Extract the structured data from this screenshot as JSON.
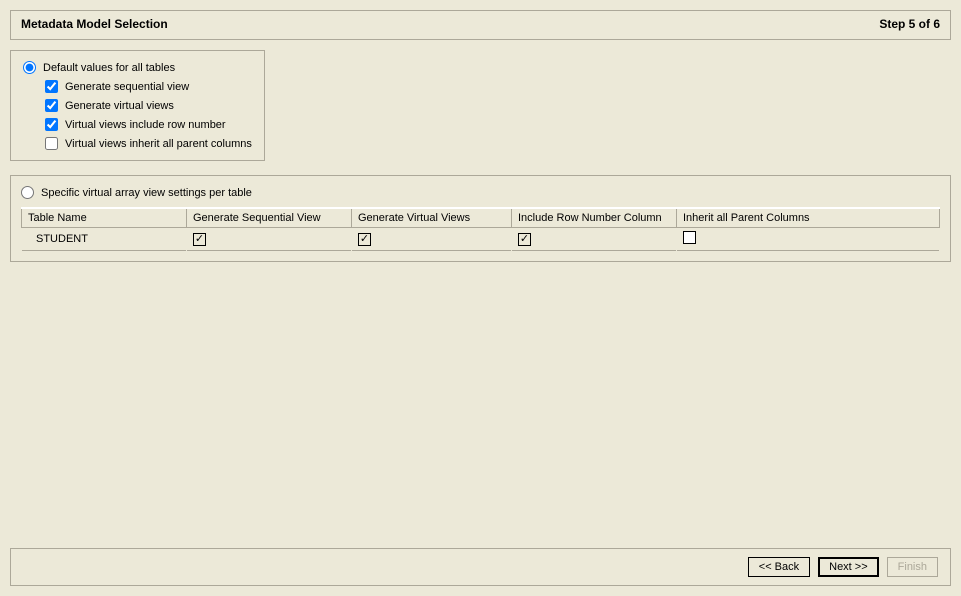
{
  "header": {
    "title": "Metadata Model Selection",
    "step": "Step 5 of 6"
  },
  "defaults": {
    "radio_label": "Default values for all tables",
    "checks": [
      {
        "label": "Generate sequential view",
        "checked": true
      },
      {
        "label": "Generate virtual views",
        "checked": true
      },
      {
        "label": "Virtual views include row number",
        "checked": true
      },
      {
        "label": "Virtual views inherit all parent columns",
        "checked": false
      }
    ]
  },
  "specific": {
    "radio_label": "Specific virtual array view settings per table",
    "columns": {
      "c0": "Table Name",
      "c1": "Generate Sequential View",
      "c2": "Generate Virtual Views",
      "c3": "Include Row Number Column",
      "c4": "Inherit all Parent Columns"
    },
    "row": {
      "name": "STUDENT"
    }
  },
  "buttons": {
    "back": "<< Back",
    "next": "Next >>",
    "finish": "Finish"
  }
}
